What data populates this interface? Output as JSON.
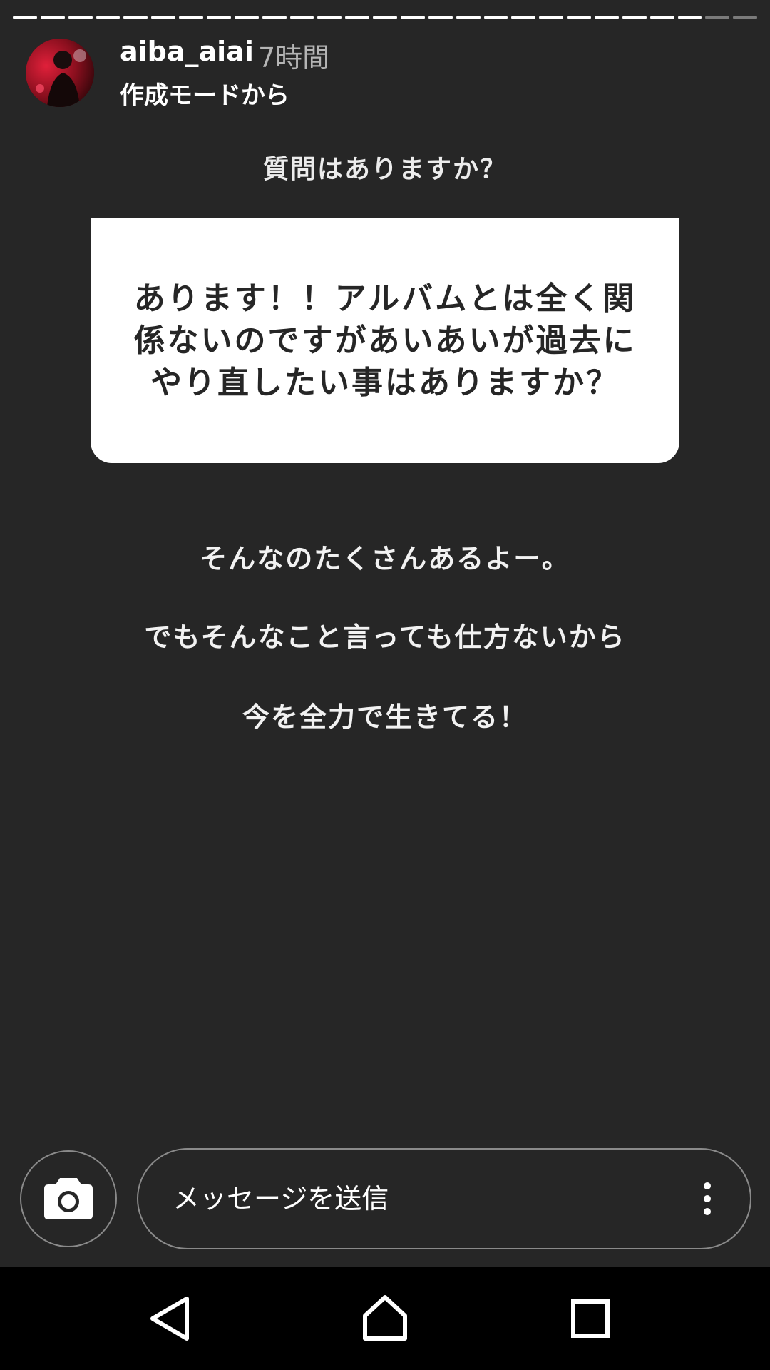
{
  "story": {
    "segments_total": 27,
    "segments_done": 25
  },
  "header": {
    "username": "aiba_aiai",
    "time_ago": "7時間",
    "subtitle": "作成モードから"
  },
  "question": {
    "header": "質問はありますか？",
    "text": "あります！！アルバムとは全く関係ないのですがあいあいが過去にやり直したい事はありますか？"
  },
  "answer": {
    "lines": [
      "そんなのたくさんあるよー。",
      "でもそんなこと言っても仕方ないから",
      "今を全力で生きてる！"
    ]
  },
  "reply_bar": {
    "placeholder": "メッセージを送信",
    "camera_icon": "camera-icon",
    "more_icon": "more-vertical-icon"
  },
  "nav": {
    "back_icon": "back-triangle-icon",
    "home_icon": "home-icon",
    "recents_icon": "recents-square-icon"
  },
  "colors": {
    "background": "#262626",
    "card": "#ffffff",
    "text": "#ffffff",
    "muted": "#b5b5b5",
    "navbar": "#000000"
  }
}
